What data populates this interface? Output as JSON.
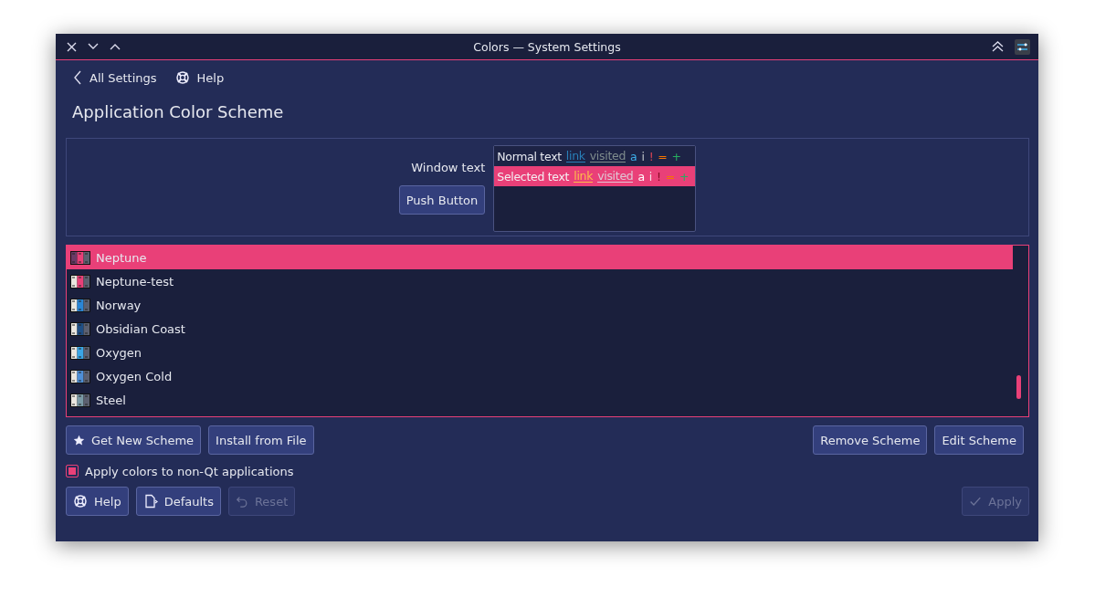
{
  "window": {
    "title": "Colors — System Settings"
  },
  "nav": {
    "back": "All Settings",
    "help": "Help"
  },
  "page_title": "Application Color Scheme",
  "preview": {
    "window_text": "Window text",
    "push_button": "Push Button",
    "rows": [
      {
        "selected": false,
        "tokens": [
          {
            "kind": "normal",
            "text": "Normal text"
          },
          {
            "kind": "link",
            "text": "link"
          },
          {
            "kind": "visited",
            "text": "visited"
          },
          {
            "kind": "active",
            "text": "a"
          },
          {
            "kind": "inactive",
            "text": "i"
          },
          {
            "kind": "negative",
            "text": "!"
          },
          {
            "kind": "neutral",
            "text": "="
          },
          {
            "kind": "positive",
            "text": "+"
          }
        ]
      },
      {
        "selected": true,
        "tokens": [
          {
            "kind": "normal",
            "text": "Selected text"
          },
          {
            "kind": "link",
            "text": "link"
          },
          {
            "kind": "visited",
            "text": "visited"
          },
          {
            "kind": "active",
            "text": "a"
          },
          {
            "kind": "inactive",
            "text": "i"
          },
          {
            "kind": "negative",
            "text": "!"
          },
          {
            "kind": "neutral",
            "text": "="
          },
          {
            "kind": "positive",
            "text": "+"
          }
        ]
      }
    ]
  },
  "schemes": [
    {
      "name": "Neptune",
      "selected": true,
      "color": "#e94078"
    },
    {
      "name": "Neptune-test",
      "selected": false,
      "color": "#e94078"
    },
    {
      "name": "Norway",
      "selected": false,
      "color": "#2a86d6"
    },
    {
      "name": "Obsidian Coast",
      "selected": false,
      "color": "#1f4f86"
    },
    {
      "name": "Oxygen",
      "selected": false,
      "color": "#3aa6e6"
    },
    {
      "name": "Oxygen Cold",
      "selected": false,
      "color": "#4e8fd6"
    },
    {
      "name": "Steel",
      "selected": false,
      "color": "#7a9aa6"
    }
  ],
  "scheme_buttons": {
    "left": [
      {
        "label": "Get New Scheme",
        "kind": "star",
        "disabled": false
      },
      {
        "label": "Install from File",
        "disabled": false
      }
    ],
    "right": [
      {
        "label": "Remove Scheme",
        "disabled": false
      },
      {
        "label": "Edit Scheme",
        "disabled": false
      }
    ]
  },
  "apply_non_qt": {
    "label": "Apply colors to non-Qt applications",
    "checked": true
  },
  "footer": {
    "left": [
      {
        "label": "Help",
        "kind": "help",
        "disabled": false
      },
      {
        "label": "Defaults",
        "kind": "defaults",
        "disabled": false
      },
      {
        "label": "Reset",
        "kind": "reset",
        "disabled": true
      }
    ],
    "right": [
      {
        "label": "Apply",
        "kind": "apply",
        "disabled": true
      }
    ]
  }
}
